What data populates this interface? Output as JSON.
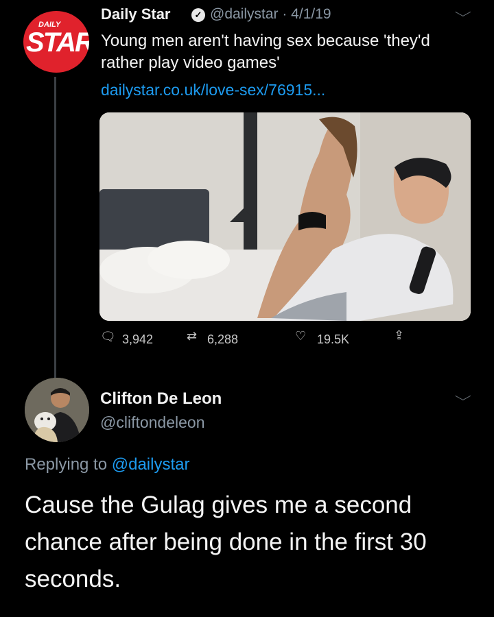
{
  "tweet": {
    "logo_top": "DAILY",
    "logo_main": "STAR",
    "display_name": "Daily Star",
    "handle_date": "@dailystar · 4/1/19",
    "text": "Young men aren't having sex because 'they'd rather play video games'",
    "link": "dailystar.co.uk/love-sex/76915...",
    "stats": {
      "replies": "3,942",
      "retweets": "6,288",
      "likes": "19.5K"
    }
  },
  "reply": {
    "display_name": "Clifton De Leon",
    "handle": "@cliftondeleon",
    "replying_prefix": "Replying to",
    "replying_to": "@dailystar",
    "text": "Cause the Gulag gives me a second chance after being done in the first 30 seconds."
  },
  "icons": {
    "reply": "reply-icon",
    "retweet": "retweet-icon",
    "like": "heart-icon",
    "share": "share-icon",
    "more": "chevron-down-icon",
    "verified": "verified-icon"
  },
  "colors": {
    "background": "#000000",
    "link": "#1d9bf0",
    "muted": "#8b98a5",
    "brand_red": "#e0222c"
  }
}
